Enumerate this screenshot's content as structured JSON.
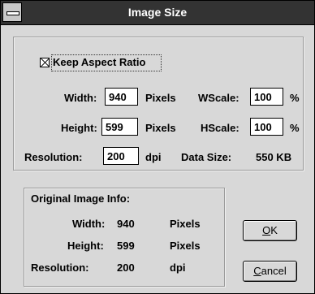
{
  "window": {
    "title": "Image Size"
  },
  "aspect": {
    "label": "Keep Aspect Ratio",
    "checked": true
  },
  "width": {
    "label": "Width:",
    "value": "940",
    "unit": "Pixels"
  },
  "height": {
    "label": "Height:",
    "value": "599",
    "unit": "Pixels"
  },
  "resolution": {
    "label": "Resolution:",
    "value": "200",
    "unit": "dpi"
  },
  "wscale": {
    "label": "WScale:",
    "value": "100",
    "unit": "%"
  },
  "hscale": {
    "label": "HScale:",
    "value": "100",
    "unit": "%"
  },
  "datasize": {
    "label": "Data Size:",
    "value": "550 KB"
  },
  "original": {
    "title": "Original Image Info:",
    "width_label": "Width:",
    "width_value": "940",
    "width_unit": "Pixels",
    "height_label": "Height:",
    "height_value": "599",
    "height_unit": "Pixels",
    "res_label": "Resolution:",
    "res_value": "200",
    "res_unit": "dpi"
  },
  "buttons": {
    "ok_prefix": "",
    "ok_mnemonic": "O",
    "ok_rest": "K",
    "cancel_mnemonic": "C",
    "cancel_rest": "ancel"
  }
}
